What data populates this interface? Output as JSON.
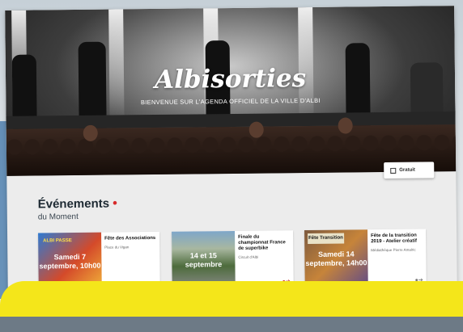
{
  "header": {
    "logo": "Albisorties",
    "tagline": "BIENVENUE SUR L'AGENDA OFFICIEL DE LA VILLE D'ALBI"
  },
  "filter": {
    "label": "Gratuit"
  },
  "section": {
    "title": "Événements",
    "subtitle": "du Moment"
  },
  "events": [
    {
      "thumb_label": "Samedi 7 septembre, 10h00",
      "thumb_badge": "ALBI PASSE",
      "title": "Fête des Associations",
      "place": "Place du Vigan"
    },
    {
      "thumb_label": "14 et 15 septembre",
      "title": "Finale du championnat France de superbike",
      "place": "Circuit d'Albi"
    },
    {
      "thumb_label": "Samedi 14 septembre, 14h00",
      "thumb_badge": "Fête Transition",
      "title": "Fête de la transition 2019 - Atelier créatif",
      "place": "Médiathèque Pierre Amalric"
    }
  ]
}
